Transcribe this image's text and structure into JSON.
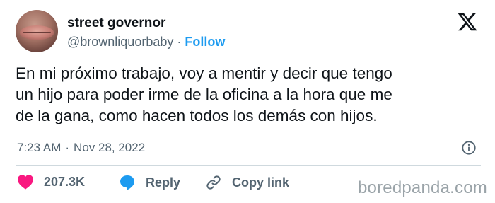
{
  "author": {
    "display_name": "street governor",
    "handle": "@brownliquorbaby",
    "separator": "·",
    "follow_label": "Follow"
  },
  "tweet": {
    "lines": [
      "En mi próximo trabajo, voy a mentir y decir que tengo",
      "un hijo para poder irme de la oficina a la hora que me",
      "de la gana, como hacen todos los demás con hijos."
    ],
    "time": "7:23 AM",
    "separator": "·",
    "date": "Nov 28, 2022"
  },
  "actions": {
    "likes_count": "207.3K",
    "reply_label": "Reply",
    "copy_link_label": "Copy link"
  },
  "watermark": "boredpanda.com",
  "colors": {
    "accent": "#1d9bf0",
    "like": "#f91880",
    "secondary_text": "#536471",
    "divider": "#cfd9de"
  },
  "icons": [
    "x-logo-icon",
    "info-icon",
    "heart-icon",
    "reply-bubble-icon",
    "link-icon"
  ]
}
